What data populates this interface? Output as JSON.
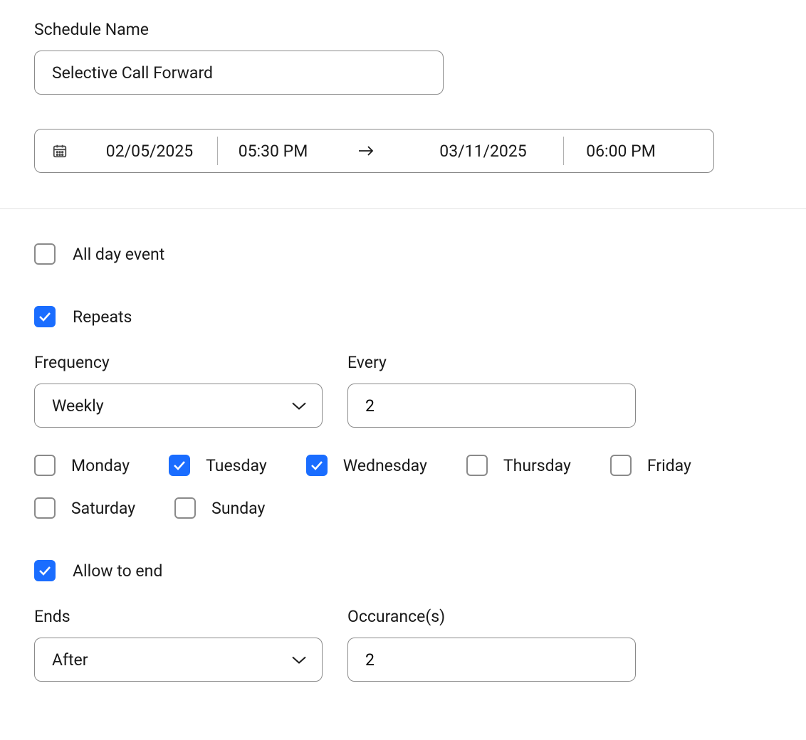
{
  "scheduleName": {
    "label": "Schedule Name",
    "value": "Selective Call Forward"
  },
  "dateRange": {
    "startDate": "02/05/2025",
    "startTime": "05:30 PM",
    "endDate": "03/11/2025",
    "endTime": "06:00 PM"
  },
  "allDay": {
    "label": "All day event",
    "checked": false
  },
  "repeats": {
    "label": "Repeats",
    "checked": true
  },
  "frequency": {
    "label": "Frequency",
    "value": "Weekly"
  },
  "every": {
    "label": "Every",
    "value": "2"
  },
  "days": [
    {
      "label": "Monday",
      "checked": false
    },
    {
      "label": "Tuesday",
      "checked": true
    },
    {
      "label": "Wednesday",
      "checked": true
    },
    {
      "label": "Thursday",
      "checked": false
    },
    {
      "label": "Friday",
      "checked": false
    },
    {
      "label": "Saturday",
      "checked": false
    },
    {
      "label": "Sunday",
      "checked": false
    }
  ],
  "allowEnd": {
    "label": "Allow to end",
    "checked": true
  },
  "ends": {
    "label": "Ends",
    "value": "After"
  },
  "occurrences": {
    "label": "Occurance(s)",
    "value": "2"
  }
}
